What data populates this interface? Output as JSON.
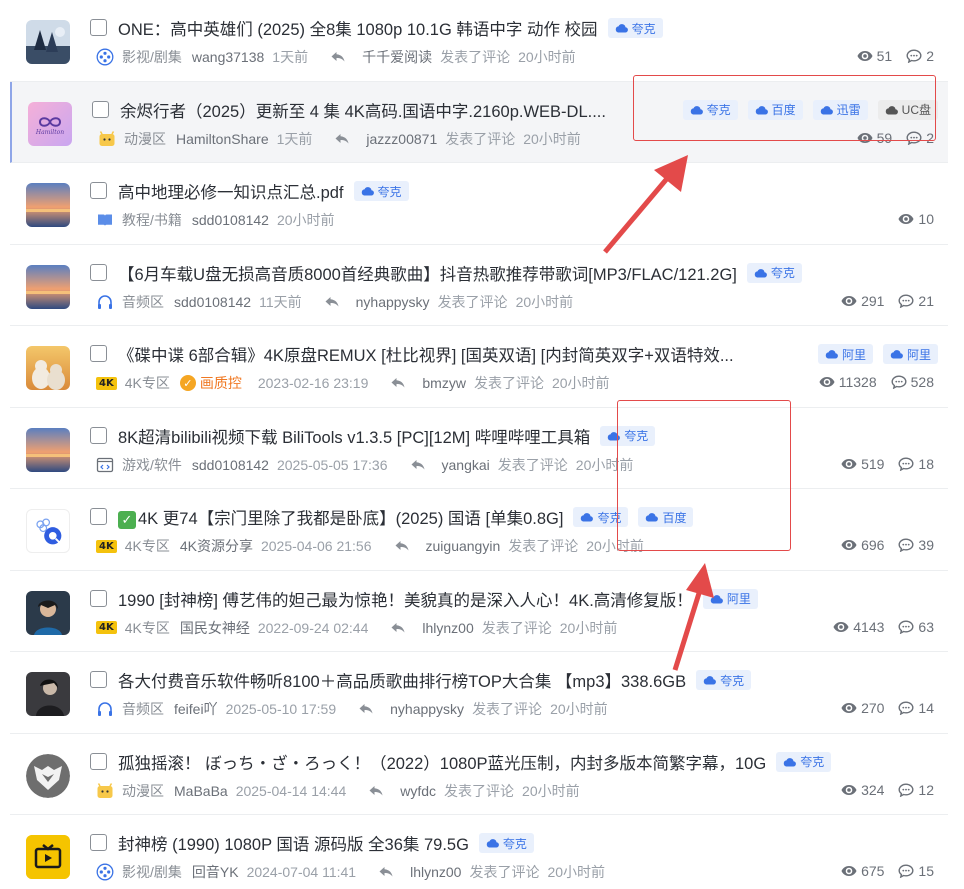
{
  "tags": {
    "quark": "夸克",
    "baidu": "百度",
    "xunlei": "迅雷",
    "uc": "UC盘",
    "aliyun": "阿里"
  },
  "action_commented": "发表了评论",
  "rows": [
    {
      "title": "ONE：高中英雄们 (2025) 全8集 1080p 10.1G 韩语中字 动作 校园",
      "category": "影视/剧集",
      "author": "wang37138",
      "post_time": "1天前",
      "replier": "千千爱阅读",
      "reply_time": "20小时前",
      "views": "51",
      "comments": "2"
    },
    {
      "title": "余烬行者（2025）更新至 4 集 4K高码.国语中字.2160p.WEB-DL....",
      "category": "动漫区",
      "author": "HamiltonShare",
      "post_time": "1天前",
      "replier": "jazzz00871",
      "reply_time": "20小时前",
      "views": "59",
      "comments": "2"
    },
    {
      "title": "高中地理必修一知识点汇总.pdf",
      "category": "教程/书籍",
      "author": "sdd0108142",
      "post_time": "20小时前",
      "views": "10"
    },
    {
      "title": "【6月车载U盘无损高音质8000首经典歌曲】抖音热歌推荐带歌词[MP3/FLAC/121.2G]",
      "category": "音频区",
      "author": "sdd0108142",
      "post_time": "11天前",
      "replier": "nyhappysky",
      "reply_time": "20小时前",
      "views": "291",
      "comments": "21"
    },
    {
      "title": "《碟中谍 6部合辑》4K原盘REMUX [杜比视界] [国英双语] [内封简英双字+双语特效...",
      "category": "4K专区",
      "hq_label": "画质控",
      "post_time": "2023-02-16 23:19",
      "replier": "bmzyw",
      "reply_time": "20小时前",
      "views": "11328",
      "comments": "528"
    },
    {
      "title": "8K超清bilibili视频下载 BiliTools v1.3.5 [PC][12M] 哔哩哔哩工具箱",
      "category": "游戏/软件",
      "author": "sdd0108142",
      "post_time": "2025-05-05 17:36",
      "replier": "yangkai",
      "reply_time": "20小时前",
      "views": "519",
      "comments": "18"
    },
    {
      "title": "4K 更74【宗门里除了我都是卧底】(2025) 国语 [单集0.8G]",
      "category": "4K专区",
      "author": "4K资源分享",
      "post_time": "2025-04-06 21:56",
      "replier": "zuiguangyin",
      "reply_time": "20小时前",
      "views": "696",
      "comments": "39"
    },
    {
      "title": "1990 [封神榜] 傅艺伟的妲己最为惊艳！美貌真的是深入人心！4K.高清修复版！",
      "category": "4K专区",
      "author": "国民女神经",
      "post_time": "2022-09-24 02:44",
      "replier": "lhlynz00",
      "reply_time": "20小时前",
      "views": "4143",
      "comments": "63"
    },
    {
      "title": "各大付费音乐软件畅听8100＋高品质歌曲排行榜TOP大合集 【mp3】338.6GB",
      "category": "音频区",
      "author": "feifei吖",
      "post_time": "2025-05-10 17:59",
      "replier": "nyhappysky",
      "reply_time": "20小时前",
      "views": "270",
      "comments": "14"
    },
    {
      "title": "孤独摇滚！ ぼっち・ざ・ろっく！（2022）1080P蓝光压制，内封多版本简繁字幕，10G",
      "category": "动漫区",
      "author": "MaBaBa",
      "post_time": "2025-04-14 14:44",
      "replier": "wyfdc",
      "reply_time": "20小时前",
      "views": "324",
      "comments": "12"
    },
    {
      "title": "封神榜 (1990) 1080P 国语 源码版 全36集 79.5G",
      "category": "影视/剧集",
      "author": "回音YK",
      "post_time": "2024-07-04 11:41",
      "replier": "lhlynz00",
      "reply_time": "20小时前",
      "views": "675",
      "comments": "15"
    }
  ],
  "colors": {
    "tag_bg": "#e9f0fc",
    "tag_text": "#3a73e6",
    "annotation_red": "#e34a4a",
    "active_row_bg": "#f4f5f7"
  }
}
